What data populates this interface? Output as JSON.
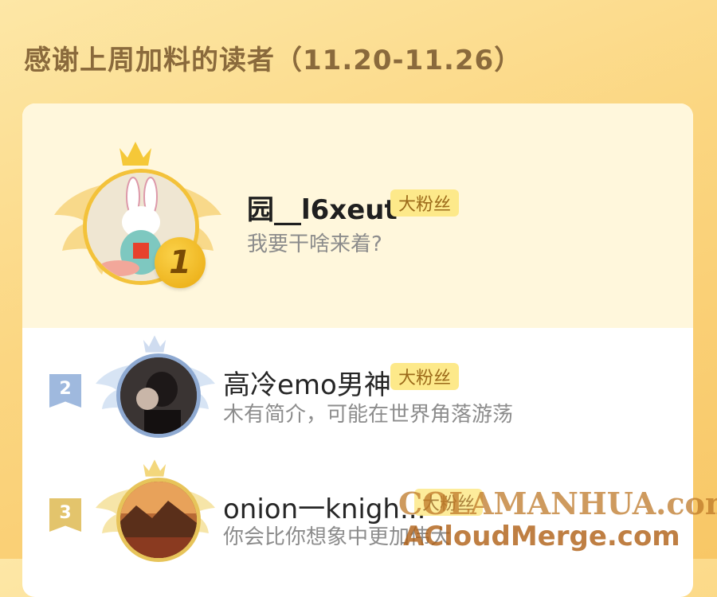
{
  "header": {
    "title": "感谢上周加料的读者（11.20-11.26）"
  },
  "readers": [
    {
      "rank": "1",
      "name": "园__l6xeut",
      "tag": "大粉丝",
      "bio": "我要干啥来着?"
    },
    {
      "rank": "2",
      "name": "高冷emo男神",
      "tag": "大粉丝",
      "bio": "木有简介，可能在世界角落游荡"
    },
    {
      "rank": "3",
      "name": "onion一knigh...",
      "tag": "大粉丝",
      "bio": "你会比你想象中更加伟大"
    }
  ],
  "watermark": {
    "line1": "COLAMANHUA.com",
    "line2": "ACloudMerge.com"
  }
}
